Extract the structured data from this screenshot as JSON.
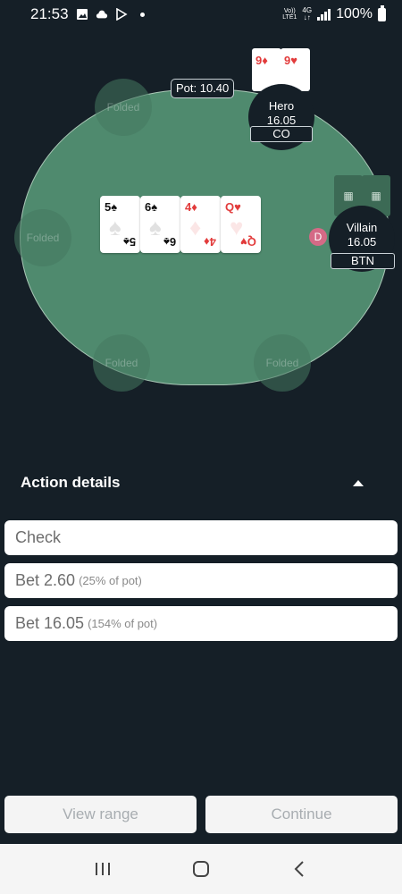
{
  "status_bar": {
    "time": "21:53",
    "volte": [
      "Vo))",
      "LTE1"
    ],
    "network": [
      "4G",
      "↓↑"
    ],
    "battery": "100%"
  },
  "table": {
    "pot": "Pot: 10.40",
    "folded_label": "Folded",
    "board": [
      {
        "rank": "5",
        "suit": "♠",
        "color": "black"
      },
      {
        "rank": "6",
        "suit": "♠",
        "color": "black"
      },
      {
        "rank": "4",
        "suit": "♦",
        "color": "red"
      },
      {
        "rank": "Q",
        "suit": "♥",
        "color": "red"
      }
    ],
    "hero": {
      "name": "Hero",
      "stack": "16.05",
      "position": "CO",
      "cards": [
        {
          "rank": "9",
          "suit": "♦"
        },
        {
          "rank": "9",
          "suit": "♥"
        }
      ]
    },
    "villain": {
      "name": "Villain",
      "stack": "16.05",
      "position": "BTN",
      "dealer_button": "D"
    }
  },
  "action_details": {
    "title": "Action details",
    "options": [
      {
        "label": "Check",
        "note": ""
      },
      {
        "label": "Bet 2.60",
        "note": "(25% of pot)"
      },
      {
        "label": "Bet 16.05",
        "note": "(154% of pot)"
      }
    ]
  },
  "footer": {
    "view_range": "View range",
    "continue": "Continue"
  },
  "colors": {
    "background": "#151f27",
    "felt": "#4f8a6e",
    "red_suit": "#e23b3b",
    "dealer": "#d46a86"
  }
}
